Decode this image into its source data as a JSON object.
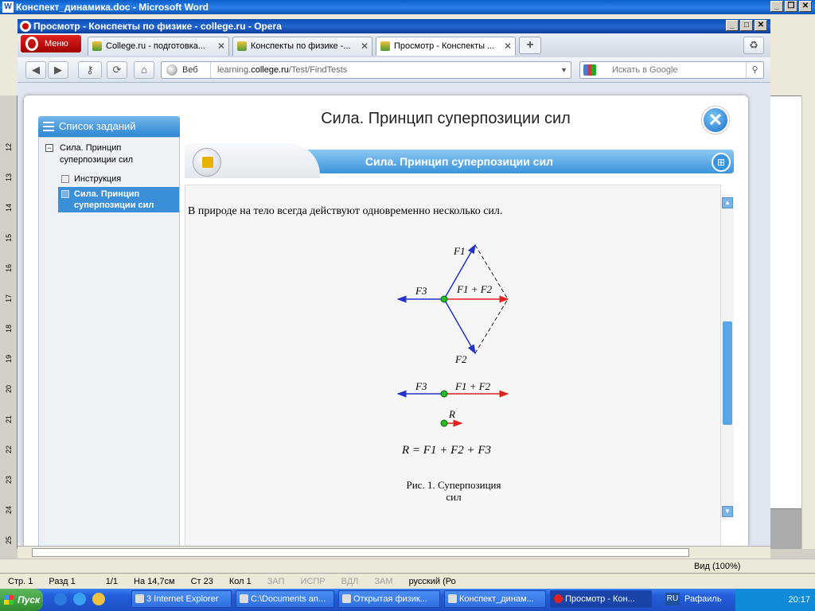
{
  "word": {
    "title": "Конспект_динамика.doc - Microsoft Word",
    "ruler_numbers": [
      "12",
      "13",
      "14",
      "15",
      "16",
      "17",
      "18",
      "19",
      "20",
      "21",
      "22",
      "23",
      "24",
      "25"
    ],
    "status": {
      "page": "Стр. 1",
      "section": "Разд 1",
      "pages": "1/1",
      "at": "На 14,7см",
      "line": "Ст 23",
      "col": "Кол 1",
      "rec": "ЗАП",
      "trk": "ИСПР",
      "ext": "ВДЛ",
      "ovr": "ЗАМ",
      "lang": "русский (Ро"
    },
    "zoom": "Вид (100%)"
  },
  "opera": {
    "title": "Просмотр - Конспекты по физике - college.ru - Opera",
    "menu_label": "Меню",
    "tabs": [
      {
        "label": "College.ru - подготовка..."
      },
      {
        "label": "Конспекты по физике -..."
      },
      {
        "label": "Просмотр - Конспекты ..."
      }
    ],
    "new_tab": "+",
    "address": {
      "scheme_label": "Веб",
      "host_pre": "learning.",
      "host_main": "college.ru",
      "path": "/Test/FindTests"
    },
    "search_placeholder": "Искать в Google"
  },
  "page": {
    "sidebar_title": "Список заданий",
    "tree_root": "Сила. Принцип суперпозиции сил",
    "tree_items": [
      {
        "label": "Инструкция",
        "selected": false
      },
      {
        "label": "Сила. Принцип суперпозиции сил",
        "selected": true
      }
    ],
    "main_title": "Сила. Принцип суперпозиции сил",
    "banner_title": "Сила. Принцип суперпозиции сил",
    "paragraph": "В природе на тело всегда действуют одновременно несколько сил.",
    "figure_labels": {
      "f1": "F1",
      "f2": "F2",
      "f3": "F3",
      "f1f2": "F1 + F2",
      "r": "R"
    },
    "formula": "R = F1 + F2 + F3",
    "caption": "Рис. 1. Суперпозиция сил"
  },
  "taskbar": {
    "start": "Пуск",
    "buttons": [
      {
        "label": "3 Internet Explorer"
      },
      {
        "label": "C:\\Documents an..."
      },
      {
        "label": "Открытая физик..."
      },
      {
        "label": "Конспект_динам..."
      },
      {
        "label": "Просмотр - Кон..."
      }
    ],
    "lang": "RU",
    "user": "Рафаиль",
    "clock": "20:17"
  },
  "colors": {
    "accent": "#3a94dc",
    "vector_blue": "#2233cc",
    "vector_red": "#dd2222",
    "point_green": "#22bb22"
  }
}
